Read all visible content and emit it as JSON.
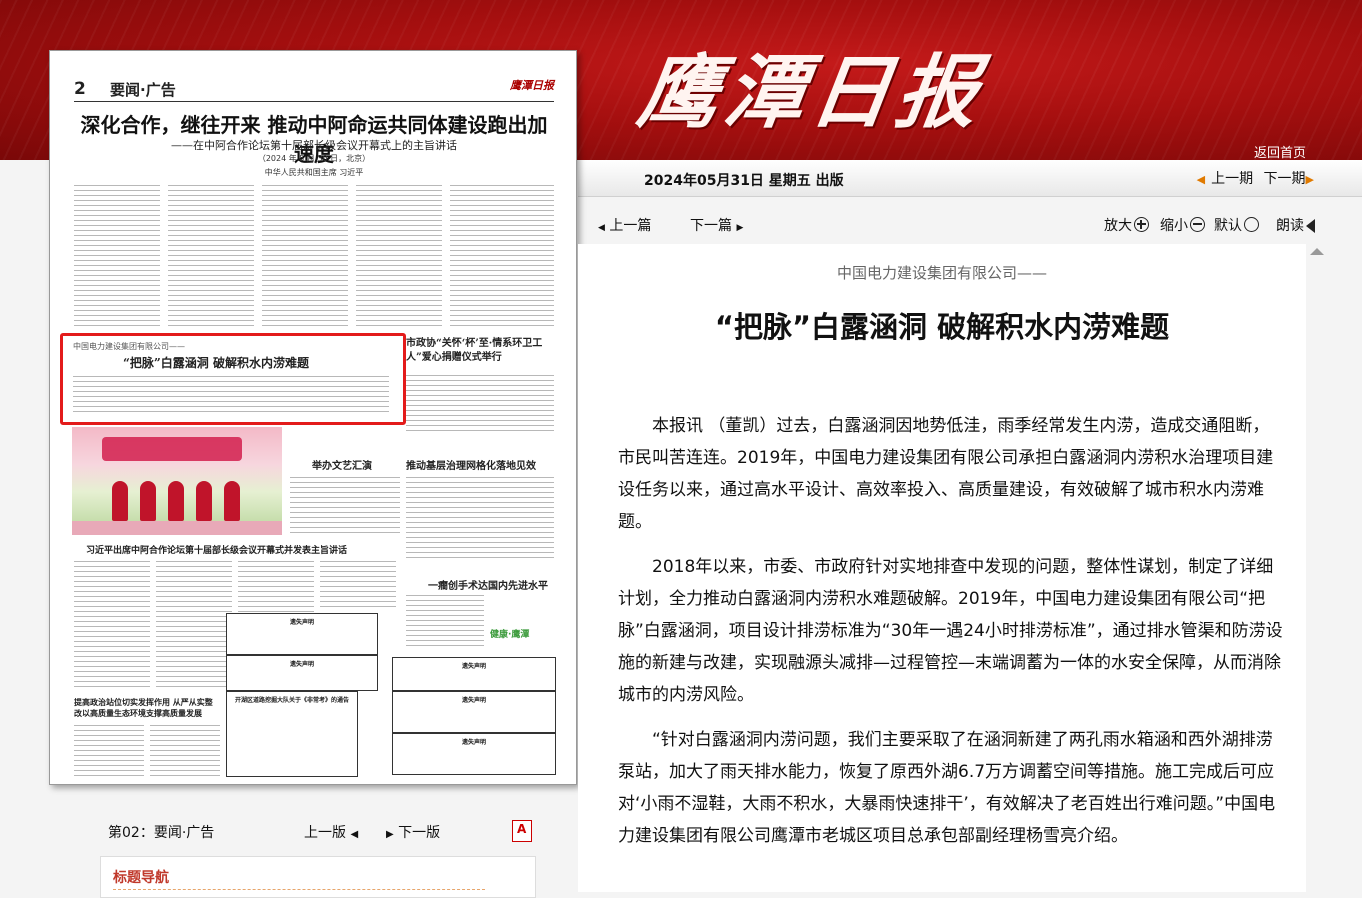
{
  "masthead": {
    "logo": "鹰潭日报",
    "home_link": "返回首页"
  },
  "issue": {
    "date": "2024年05月31日 星期五 出版",
    "prev_issue": "上一期",
    "next_issue": "下一期"
  },
  "toolbar": {
    "prev_article": "上一篇",
    "next_article": "下一篇",
    "zoom_in": "放大",
    "zoom_out": "缩小",
    "default": "默认",
    "read_aloud": "朗读"
  },
  "paper_page": {
    "number": "2",
    "section": "要闻·广告",
    "mini_logo": "鹰潭日报",
    "headline": "深化合作，继往开来  推动中阿命运共同体建设跑出加速度",
    "subheadline": "——在中阿合作论坛第十届部长级会议开幕式上的主旨讲话",
    "dateline": "（2024 年 5 月 30 日，北京）",
    "author": "中华人民共和国主席  习近平",
    "boxed_org": "中国电力建设集团有限公司——",
    "boxed_title": "“把脉”白露涵洞    破解积水内涝难题",
    "right_head": "市政协“关怀‘杯’至·情系环卫工人”爱心捐赠仪式举行",
    "photo_caption": "习近平出席中阿合作论坛第十届部长级会议开幕式并发表主旨讲话",
    "mid_head_1": "举办文艺汇演",
    "mid_head_2": "推动基层治理网格化落地见效",
    "mid_head_3": "一癎创手术达国内先进水平",
    "left_head_bottom": "提高政治站位切实发挥作用  从严从实整改以高质量生态环境支撑高质量发展",
    "notice_title": "遗失声明",
    "notice_public": "开湖区道路挖掘大队关于《非常考》的通告",
    "health_brand": "健康·鹰潭"
  },
  "page_footer": {
    "page_label": "第02：要闻·广告",
    "prev_page": "上一版",
    "next_page": "下一版"
  },
  "nav_panel": {
    "title": "标题导航"
  },
  "article": {
    "kicker": "中国电力建设集团有限公司——",
    "title": "“把脉”白露涵洞 破解积水内涝难题",
    "paragraphs": [
      "本报讯  （董凯）过去，白露涵洞因地势低洼，雨季经常发生内涝，造成交通阻断，市民叫苦连连。2019年，中国电力建设集团有限公司承担白露涵洞内涝积水治理项目建设任务以来，通过高水平设计、高效率投入、高质量建设，有效破解了城市积水内涝难题。",
      "2018年以来，市委、市政府针对实地排查中发现的问题，整体性谋划，制定了详细计划，全力推动白露涵洞内涝积水难题破解。2019年，中国电力建设集团有限公司“把脉”白露涵洞，项目设计排涝标准为“30年一遇24小时排涝标准”，通过排水管渠和防涝设施的新建与改建，实现融源头减排—过程管控—末端调蓄为一体的水安全保障，从而消除城市的内涝风险。",
      "“针对白露涵洞内涝问题，我们主要采取了在涵洞新建了两孔雨水箱涵和西外湖排涝泵站，加大了雨天排水能力，恢复了原西外湖6.7万方调蓄空间等措施。施工完成后可应对‘小雨不湿鞋，大雨不积水，大暴雨快速排干’，有效解决了老百姓出行难问题。”中国电力建设集团有限公司鹰潭市老城区项目总承包部副经理杨雪亮介绍。"
    ]
  },
  "colors": {
    "masthead_red": "#a50f0f",
    "highlight_box": "#e31b1b",
    "nav_title": "#c0392b"
  }
}
